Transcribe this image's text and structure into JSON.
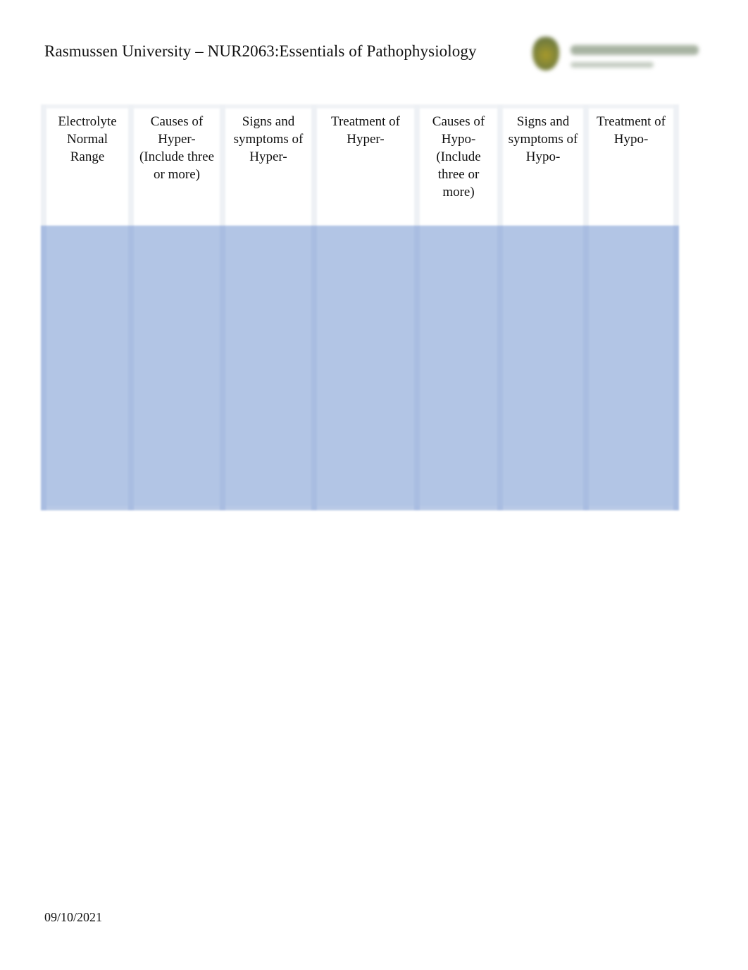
{
  "header": {
    "title": "Rasmussen  University – NUR2063:Essentials of Pathophysiology",
    "logo": "rasmussen-university-logo"
  },
  "table": {
    "columns": [
      {
        "label": "Electrolyte\nNormal\nRange"
      },
      {
        "label": "Causes of\nHyper-\n(Include three\nor more)"
      },
      {
        "label": "Signs and\nsymptoms of\nHyper-"
      },
      {
        "label": "Treatment of\nHyper-"
      },
      {
        "label": "Causes of\nHypo-\n(Include\nthree or\nmore)"
      },
      {
        "label": "Signs and\nsymptoms of\nHypo-"
      },
      {
        "label": "Treatment of\nHypo-"
      }
    ],
    "rows": [
      [
        "",
        "",
        "",
        "",
        "",
        "",
        ""
      ]
    ],
    "colors": {
      "header_bg": "#ffffff",
      "body_bg": "#b2c5e5"
    }
  },
  "footer": {
    "date": "09/10/2021"
  }
}
